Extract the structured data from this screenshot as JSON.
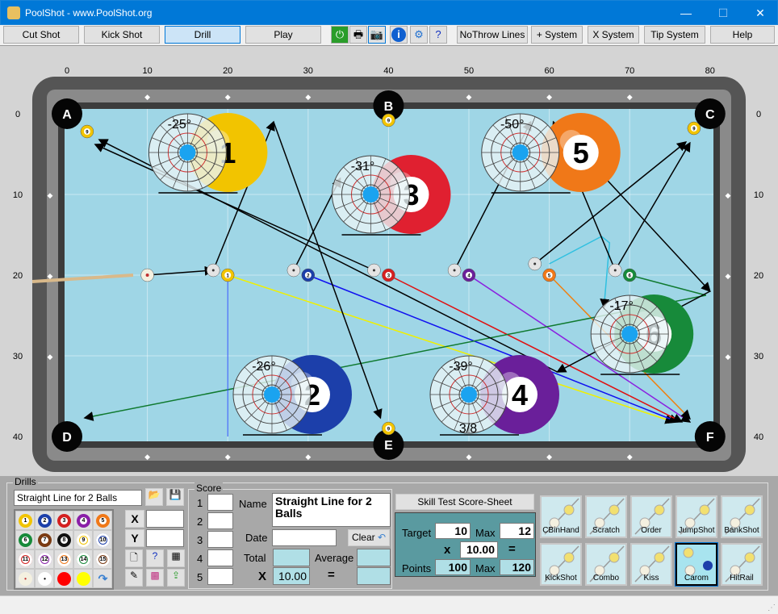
{
  "window": {
    "title": "PoolShot - www.PoolShot.org",
    "minimize": "—",
    "maximize": "☐",
    "close": "✕"
  },
  "toolbar": {
    "buttons": [
      {
        "label": "Cut Shot"
      },
      {
        "label": "Kick Shot"
      },
      {
        "label": "Drill",
        "selected": true
      },
      {
        "label": "Play"
      }
    ],
    "icons": [
      "power-icon",
      "printer-icon",
      "camera-icon",
      "info-icon",
      "gear-icon",
      "help-document-icon"
    ],
    "right_buttons": [
      {
        "label": "NoThrow Lines"
      },
      {
        "label": "+ System"
      },
      {
        "label": "X System"
      },
      {
        "label": "Tip System"
      },
      {
        "label": "Help"
      }
    ]
  },
  "table": {
    "x_ticks": [
      "0",
      "10",
      "20",
      "30",
      "40",
      "50",
      "60",
      "70",
      "80"
    ],
    "y_ticks": [
      "0",
      "10",
      "20",
      "30",
      "40"
    ],
    "pockets": [
      {
        "label": "A",
        "x": 0,
        "y": 0
      },
      {
        "label": "B",
        "x": 40,
        "y": -1
      },
      {
        "label": "C",
        "x": 80,
        "y": 0
      },
      {
        "label": "D",
        "x": 0,
        "y": 40
      },
      {
        "label": "E",
        "x": 40,
        "y": 41
      },
      {
        "label": "F",
        "x": 80,
        "y": 40
      }
    ],
    "cue_ball": {
      "x": 10,
      "y": 20
    },
    "nine_balls": [
      {
        "x": 2.5,
        "y": 2.2
      },
      {
        "x": 40,
        "y": 0.8
      },
      {
        "x": 78,
        "y": 1.8
      },
      {
        "x": 40,
        "y": 39
      }
    ],
    "object_balls": [
      {
        "n": "1",
        "x": 20,
        "y": 20,
        "color": "#f2c400"
      },
      {
        "n": "2",
        "x": 30,
        "y": 20,
        "color": "#1c3faa"
      },
      {
        "n": "3",
        "x": 40,
        "y": 20,
        "color": "#d42020"
      },
      {
        "n": "4",
        "x": 50,
        "y": 20,
        "color": "#6a1f9a"
      },
      {
        "n": "5",
        "x": 60,
        "y": 20,
        "color": "#f07818"
      },
      {
        "n": "6",
        "x": 70,
        "y": 20,
        "color": "#178a3a"
      }
    ],
    "ghost_balls": [
      {
        "x": 18.2,
        "y": 19.4
      },
      {
        "x": 28.2,
        "y": 19.4
      },
      {
        "x": 38.2,
        "y": 19.4
      },
      {
        "x": 48.2,
        "y": 19.4
      },
      {
        "x": 58.2,
        "y": 18.6
      },
      {
        "x": 68.2,
        "y": 19.4
      }
    ],
    "overlays": [
      {
        "n": "1",
        "angle": "-25°",
        "x": 15,
        "y": 4.8,
        "color": "#f2c400"
      },
      {
        "n": "3",
        "angle": "-31°",
        "x": 37.8,
        "y": 10,
        "color": "#e02030"
      },
      {
        "n": "5",
        "angle": "-50°",
        "x": 56.4,
        "y": 4.8,
        "color": "#f07818"
      },
      {
        "n": "2",
        "angle": "-26°",
        "x": 25.5,
        "y": 34.8,
        "color": "#1c3faa"
      },
      {
        "n": "4",
        "angle": "-39°",
        "x": 50,
        "y": 34.8,
        "color": "#6a1f9a"
      },
      {
        "n": "6",
        "angle": "-17°",
        "x": 70,
        "y": 27.3,
        "color": "#178a3a"
      }
    ],
    "fraction_label": "3/8",
    "colors": {
      "cloth": "#9fd6e6",
      "rail": "#6a6a6a",
      "aim": "#1aa3f0"
    }
  },
  "drills": {
    "group_label": "Drills",
    "name": "Straight Line for 2 Balls",
    "balls": [
      "1",
      "2",
      "3",
      "4",
      "5",
      "6",
      "7",
      "8",
      "9",
      "10",
      "11",
      "12",
      "13",
      "14",
      "15"
    ],
    "ball_colors": [
      "#f2c400",
      "#1c3faa",
      "#d42020",
      "#8a1fa8",
      "#f07818",
      "#178a3a",
      "#7a3a12",
      "#111111",
      "#f2c400",
      "#1c3faa",
      "#d42020",
      "#8a1fa8",
      "#f07818",
      "#178a3a",
      "#7a3a12"
    ],
    "x_label": "X",
    "y_label": "Y",
    "x_value": "",
    "y_value": ""
  },
  "score": {
    "group_label": "Score",
    "rows": [
      "1",
      "2",
      "3",
      "4",
      "5"
    ],
    "name_label": "Name",
    "name_value": "Straight Line for 2 Balls",
    "date_label": "Date",
    "date_value": "",
    "clear_label": "Clear",
    "total_label": "Total",
    "average_label": "Average",
    "x_label": "X",
    "multiplier": "10.00",
    "equals": "="
  },
  "skill": {
    "title": "Skill Test Score-Sheet",
    "target_label": "Target",
    "target": "10",
    "max_label": "Max",
    "max": "12",
    "x_label": "x",
    "multiplier": "10.00",
    "equals": "=",
    "points_label": "Points",
    "points": "100",
    "points_max_label": "Max",
    "points_max": "120"
  },
  "shot_types": [
    {
      "label": "CBinHand"
    },
    {
      "label": "Scratch"
    },
    {
      "label": "Order"
    },
    {
      "label": "JumpShot"
    },
    {
      "label": "BankShot"
    },
    {
      "label": "KickShot"
    },
    {
      "label": "Combo"
    },
    {
      "label": "Kiss"
    },
    {
      "label": "Carom",
      "selected": true
    },
    {
      "label": "HitRail"
    }
  ]
}
